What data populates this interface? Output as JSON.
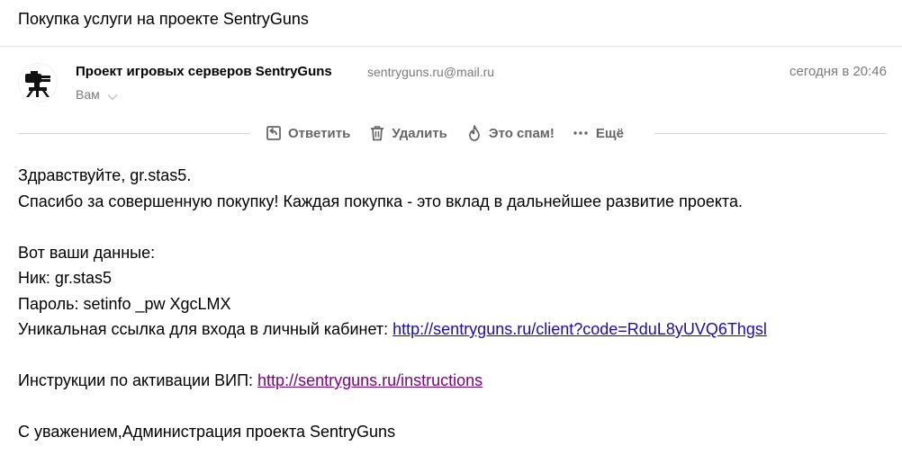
{
  "subject": "Покупка услуги на проекте SentryGuns",
  "sender": {
    "name": "Проект игровых серверов SentryGuns",
    "email": "sentryguns.ru@mail.ru",
    "date": "сегодня в 20:46",
    "recipient": "Вам"
  },
  "toolbar": {
    "reply_label": "Ответить",
    "delete_label": "Удалить",
    "spam_label": "Это спам!",
    "more_label": "Ещё"
  },
  "body": {
    "greeting": "Здравствуйте, gr.stas5.",
    "thanks": "Спасибо за совершенную покупку! Каждая покупка - это вклад в дальнейшее развитие проекта.",
    "data_header": "Вот ваши данные:",
    "nick": "Ник: gr.stas5",
    "password": "Пароль: setinfo _pw XgcLMX",
    "cabinet_prefix": "Уникальная ссылка для входа в личный кабинет: ",
    "cabinet_link": "http://sentryguns.ru/client?code=RduL8yUVQ6Thgsl",
    "vip_prefix": "Инструкции по активации ВИП: ",
    "vip_link": "http://sentryguns.ru/instructions",
    "signature": "С уважением,Администрация проекта SentryGuns"
  },
  "colors": {
    "link": "#1a0dab",
    "link_visited": "#800080",
    "muted": "#7a7a7a",
    "toolbar_text": "#666666"
  }
}
